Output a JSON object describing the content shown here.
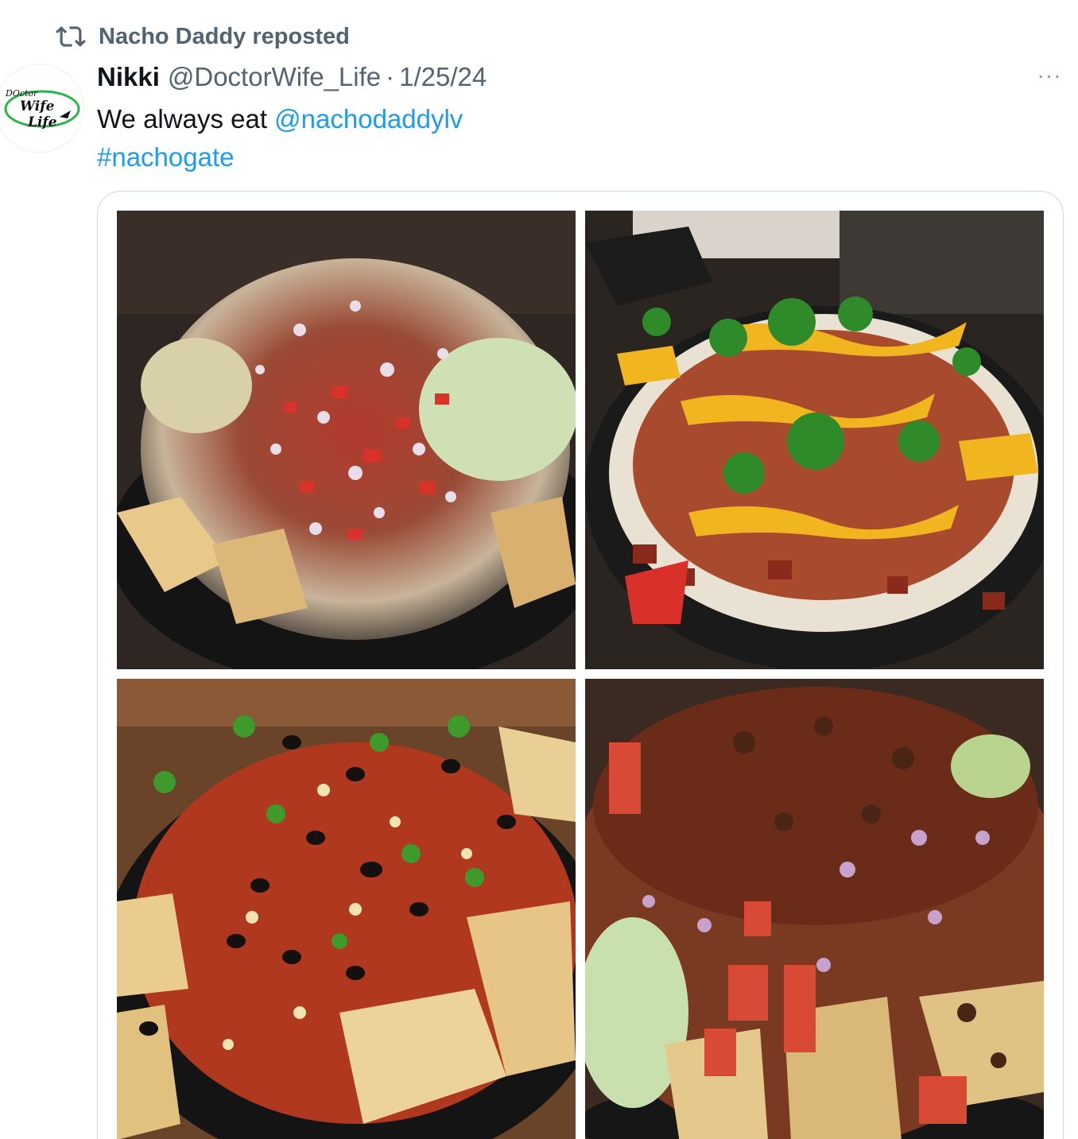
{
  "repost": {
    "icon": "repost-icon",
    "label": "Nacho Daddy reposted"
  },
  "author": {
    "avatar_text_1": "DOctor",
    "avatar_text_2": "Wife",
    "avatar_text_3": "Life",
    "name": "Nikki",
    "handle": "@DoctorWife_Life",
    "separator": "·",
    "date": "1/25/24"
  },
  "more_menu": {
    "icon": "more-icon",
    "label": "···"
  },
  "post": {
    "text_prefix": "We always eat ",
    "mention": "@nachodaddylv",
    "hashtag": "#nachogate"
  },
  "media": {
    "photos": [
      {
        "alt": "photo-nachos-bacon-tomato"
      },
      {
        "alt": "photo-nachos-cheese-cilantro"
      },
      {
        "alt": "photo-nachos-black-beans-corn"
      },
      {
        "alt": "photo-nachos-bacon-lettuce"
      }
    ]
  },
  "colors": {
    "link": "#1d9bf0",
    "secondary_text": "#536471",
    "primary_text": "#0f1419",
    "border": "#cfd9de"
  }
}
